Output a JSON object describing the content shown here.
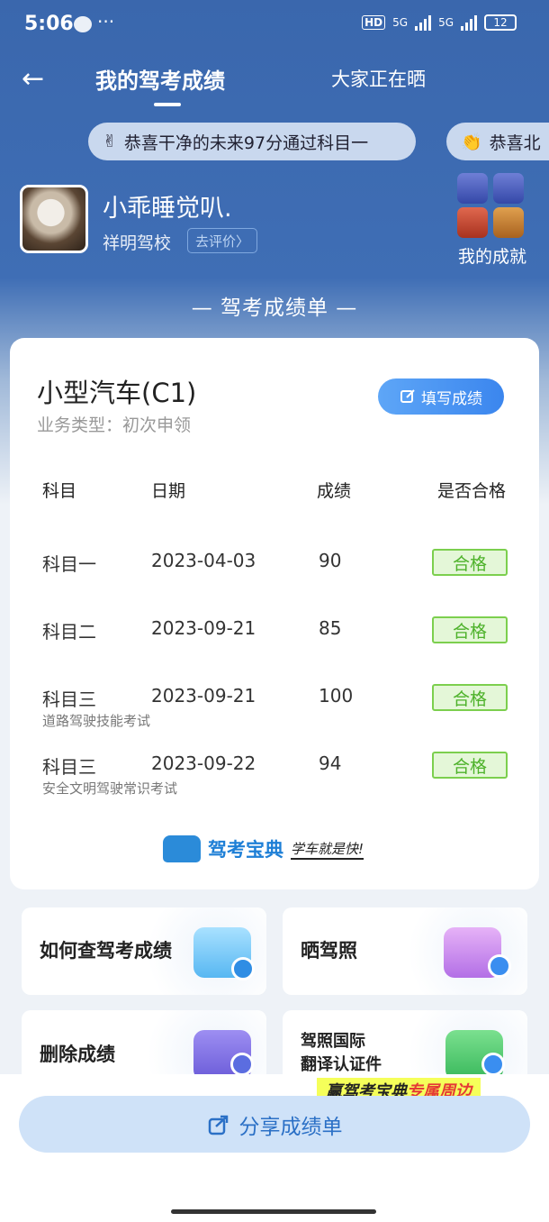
{
  "status": {
    "time": "5:06",
    "more": "···",
    "hd": "HD",
    "net1": "5G",
    "net2": "5G",
    "battery": "12"
  },
  "nav": {
    "back_icon": "←",
    "tab_active": "我的驾考成绩",
    "tab_other": "大家正在晒"
  },
  "tickers": [
    {
      "emoji": "✌",
      "text": "恭喜干净的未来97分通过科目一"
    },
    {
      "emoji": "👏",
      "text": "恭喜北"
    }
  ],
  "profile": {
    "username": "小乖睡觉叭.",
    "school": "祥明驾校",
    "review_label": "去评价〉"
  },
  "achievements": {
    "label": "我的成就"
  },
  "sheet_title": "— 驾考成绩单 —",
  "card": {
    "car_type": "小型汽车(C1)",
    "business_type": "业务类型：初次申领",
    "fill_button": "填写成绩",
    "headers": [
      "科目",
      "日期",
      "成绩",
      "是否合格"
    ],
    "rows": [
      {
        "subject": "科目一",
        "date": "2023-04-03",
        "score": "90",
        "result": "合格",
        "sub": ""
      },
      {
        "subject": "科目二",
        "date": "2023-09-21",
        "score": "85",
        "result": "合格",
        "sub": ""
      },
      {
        "subject": "科目三",
        "date": "2023-09-21",
        "score": "100",
        "result": "合格",
        "sub": "道路驾驶技能考试"
      },
      {
        "subject": "科目三",
        "date": "2023-09-22",
        "score": "94",
        "result": "合格",
        "sub": "安全文明驾驶常识考试"
      }
    ],
    "brand_name": "驾考宝典",
    "brand_slogan": "学车就是快!"
  },
  "tiles": {
    "how_to_check": "如何查驾考成绩",
    "show_license": "晒驾照",
    "delete_scores": "删除成绩",
    "intl_line1": "驾照国际",
    "intl_line2": "翻译认证件"
  },
  "promo": {
    "prefix": "赢驾考宝典",
    "highlight": "专属周边"
  },
  "share_label": "分享成绩单",
  "colors": {
    "primary": "#3a67ad",
    "accent": "#3b86ee",
    "pass": "#4db22a"
  }
}
